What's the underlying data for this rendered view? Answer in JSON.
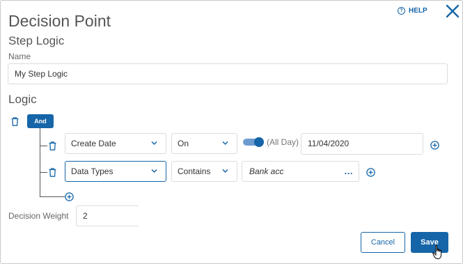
{
  "dialog": {
    "title": "Decision Point",
    "help_label": "HELP",
    "section_title": "Step Logic",
    "name_label": "Name",
    "name_value": "My Step Logic",
    "logic_title": "Logic",
    "group_operator": "And",
    "conditions": [
      {
        "field": "Create Date",
        "operator": "On",
        "all_day_toggle": true,
        "all_day_label": "(All Day)",
        "value": "11/04/2020"
      },
      {
        "field": "Data Types",
        "operator": "Contains",
        "value": "Bank acc",
        "more_label": "…"
      }
    ],
    "weight_label": "Decision Weight",
    "weight_value": "2",
    "cancel_label": "Cancel",
    "save_label": "Save"
  },
  "icons": {
    "help": "help-circle-icon",
    "close": "close-icon",
    "delete": "trash-icon",
    "chevron": "chevron-down-icon",
    "add": "plus-circle-icon",
    "cursor": "hand-pointer-icon"
  },
  "colors": {
    "accent": "#1565a8",
    "toggle_track": "#6c9bd0",
    "border": "#dcdcdc",
    "text": "#333333"
  }
}
